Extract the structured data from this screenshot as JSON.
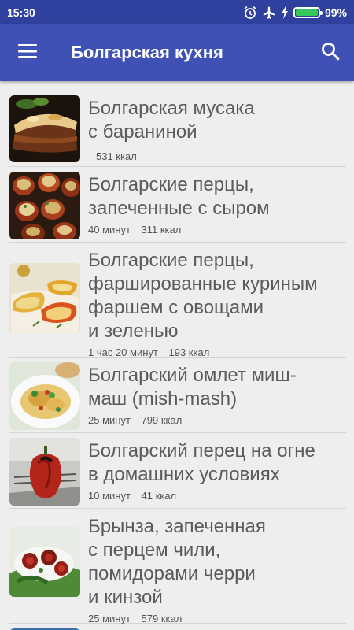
{
  "status": {
    "time": "15:30",
    "battery": "99%",
    "battery_level": 0.99,
    "icons": [
      "alarm-icon",
      "airplane-icon",
      "charging-icon",
      "battery-icon"
    ]
  },
  "appbar": {
    "title": "Болгарская кухня",
    "menu_icon": "hamburger-icon",
    "search_icon": "search-icon",
    "color": "#3f51b5"
  },
  "recipes": [
    {
      "title_lines": [
        "Болгарская мусака",
        "с бараниной"
      ],
      "time": "",
      "kcal": "531 ккал",
      "image": "moussaka"
    },
    {
      "title_lines": [
        "Болгарские перцы,",
        "запеченные с сыром"
      ],
      "time": "40 минут",
      "kcal": "311 ккал",
      "image": "baked-peppers"
    },
    {
      "title_lines": [
        "Болгарские перцы,",
        "фаршированные куриным",
        "фаршем с овощами",
        "и зеленью"
      ],
      "time": "1 час 20 минут",
      "kcal": "193 ккал",
      "image": "stuffed-peppers"
    },
    {
      "title_lines": [
        "Болгарский омлет миш-",
        "маш (mish-mash)"
      ],
      "time": "25 минут",
      "kcal": "799 ккал",
      "image": "omelette"
    },
    {
      "title_lines": [
        "Болгарский перец на огне",
        "в домашних условиях"
      ],
      "time": "10 минут",
      "kcal": "41 ккал",
      "image": "roasted-pepper"
    },
    {
      "title_lines": [
        "Брынза, запеченная",
        "с перцем чили,",
        "помидорами черри",
        "и кинзой"
      ],
      "time": "25 минут",
      "kcal": "579 ккал",
      "image": "baked-cheese"
    }
  ]
}
